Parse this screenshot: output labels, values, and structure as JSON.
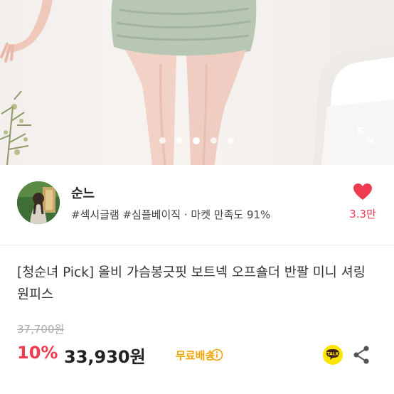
{
  "gallery": {
    "dot_count": 5,
    "active_dot": 2,
    "expand_icon": "expand-icon"
  },
  "seller": {
    "name": "순느",
    "tags": "#섹시글램 #심플베이직 · 마켓 만족도 91%",
    "like_count": "3.3만",
    "like_icon": "heart-icon",
    "heart_color": "#ee3b52"
  },
  "product": {
    "title": "[청순녀 Pick] 올비 가슴봉긋핏 보트넥 오프숄더 반팔 미니 셔링 원피스",
    "original_price": "37,700원",
    "discount": "10%",
    "price": "33,930원",
    "shipping": "무료배송",
    "shipping_color": "#f0a500",
    "discount_color": "#ee3b52",
    "talk_label": "TALK",
    "share_icon": "share-icon",
    "info_icon": "info-icon"
  }
}
